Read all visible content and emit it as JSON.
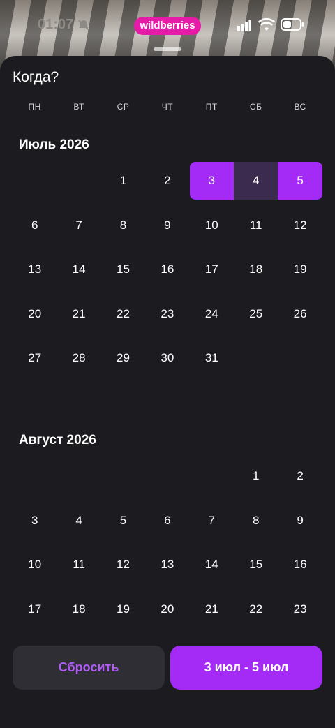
{
  "status_bar": {
    "time": "01:07",
    "badge": "wildberries"
  },
  "sheet": {
    "title": "Когда?"
  },
  "weekdays": [
    "ПН",
    "ВТ",
    "СР",
    "ЧТ",
    "ПТ",
    "СБ",
    "ВС"
  ],
  "months": [
    {
      "title": "Июль 2026",
      "first_weekday": 2,
      "days": 31,
      "selection": {
        "start": 3,
        "end": 5
      }
    },
    {
      "title": "Август 2026",
      "first_weekday": 5,
      "days": 23
    }
  ],
  "footer": {
    "reset_label": "Сбросить",
    "apply_label": "3 июл - 5 июл"
  },
  "colors": {
    "accent": "#a32bf5",
    "range_mid": "#3b2b4e",
    "background": "#1c1b1f",
    "brand_pill": "#e61ba8"
  }
}
